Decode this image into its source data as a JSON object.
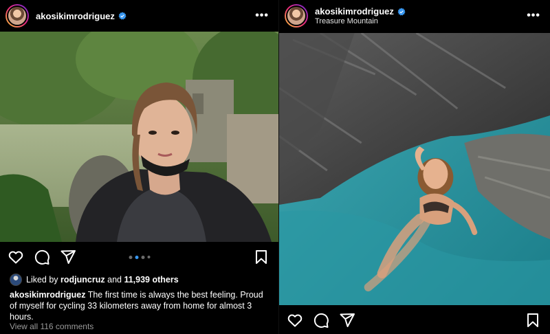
{
  "left_post": {
    "username": "akosikimrodriguez",
    "carousel": {
      "count": 4,
      "active": 2
    },
    "likes": {
      "prefix": "Liked by",
      "liker": "rodjuncruz",
      "conjunction": "and",
      "others": "11,939 others"
    },
    "caption": {
      "username": "akosikimrodriguez",
      "text": "The first time is always the best feeling. Proud of myself for cycling 33 kilometers away from home for almost 3 hours."
    },
    "view_comments": "View all 116 comments"
  },
  "right_post": {
    "username": "akosikimrodriguez",
    "location": "Treasure Mountain"
  },
  "icons": {
    "verified": "verified-badge-icon",
    "more": "more-options-icon",
    "like": "heart-icon",
    "comment": "comment-bubble-icon",
    "share": "paper-plane-icon",
    "save": "bookmark-icon"
  },
  "colors": {
    "background": "#000000",
    "text": "#ffffff",
    "verified_blue": "#3897f0",
    "muted": "#9a9a9a"
  }
}
